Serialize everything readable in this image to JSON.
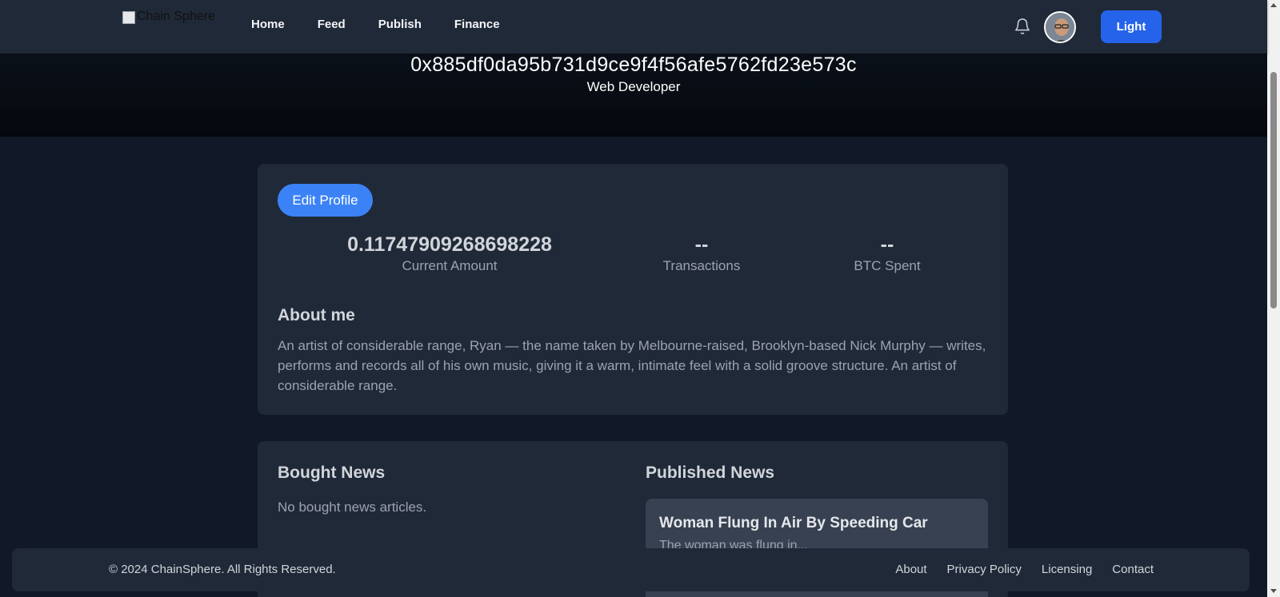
{
  "nav": {
    "logo_alt": "Chain Sphere",
    "links": [
      "Home",
      "Feed",
      "Publish",
      "Finance"
    ],
    "theme_button": "Light",
    "notification_icon": "bell-icon"
  },
  "hero": {
    "wallet_address": "0x885df0da95b731d9ce9f4f56afe5762fd23e573c",
    "role": "Web Developer"
  },
  "profile": {
    "edit_button": "Edit Profile",
    "stats": [
      {
        "value": "0.11747909268698228",
        "label": "Current Amount"
      },
      {
        "value": "--",
        "label": "Transactions"
      },
      {
        "value": "--",
        "label": "BTC Spent"
      }
    ],
    "about_title": "About me",
    "about_text": "An artist of considerable range, Ryan — the name taken by Melbourne-raised, Brooklyn-based Nick Murphy — writes, performs and records all of his own music, giving it a warm, intimate feel with a solid groove structure. An artist of considerable range."
  },
  "news": {
    "bought_title": "Bought News",
    "bought_empty": "No bought news articles.",
    "published_title": "Published News",
    "published": [
      {
        "title": "Woman Flung In Air By Speeding Car",
        "snippet": "The woman was flung in..."
      }
    ]
  },
  "footer": {
    "copyright": "© 2024 ChainSphere. All Rights Reserved.",
    "links": [
      "About",
      "Privacy Policy",
      "Licensing",
      "Contact"
    ]
  }
}
